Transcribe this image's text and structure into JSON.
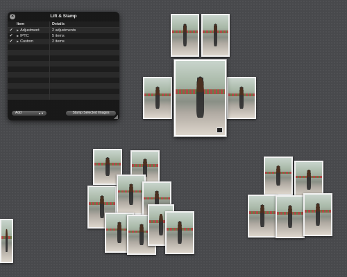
{
  "panel": {
    "title": "Lift & Stamp",
    "columns": {
      "item": "Item",
      "details": "Details"
    },
    "rows": [
      {
        "checked": true,
        "item": "Adjustment",
        "details": "2 adjustments"
      },
      {
        "checked": true,
        "item": "IPTC",
        "details": "5 items"
      },
      {
        "checked": true,
        "item": "Custom",
        "details": "2 items"
      }
    ],
    "add_label": "Add",
    "stamp_label": "Stamp Selected Images"
  },
  "icons": {
    "close": "close-icon",
    "check": "checkmark-icon",
    "disclosure": "disclosure-triangle-icon",
    "resize": "resize-grip-icon",
    "adjustment_badge": "adjustment-badge-icon"
  }
}
